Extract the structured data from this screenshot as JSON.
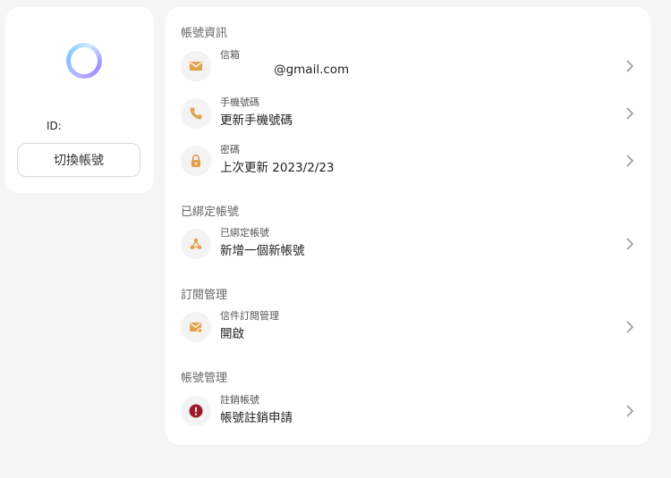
{
  "profile": {
    "id_label": "ID:",
    "switch_button": "切換帳號"
  },
  "sections": {
    "account_info": "帳號資訊",
    "bound_accounts": "已綁定帳號",
    "subscription": "訂閱管理",
    "account_management": "帳號管理"
  },
  "rows": {
    "email": {
      "label": "信箱",
      "value": "              @gmail.com",
      "icon": "mail-icon"
    },
    "phone": {
      "label": "手機號碼",
      "value": "更新手機號碼",
      "icon": "phone-icon"
    },
    "password": {
      "label": "密碼",
      "value": "上次更新 2023/2/23",
      "icon": "lock-icon"
    },
    "bound": {
      "label": "已綁定帳號",
      "value": "新增一個新帳號",
      "icon": "link-nodes-icon"
    },
    "mail_subscription": {
      "label": "信件訂閱管理",
      "value": "開啟",
      "icon": "mail-settings-icon"
    },
    "delete_account": {
      "label": "註銷帳號",
      "value": "帳號註銷申請",
      "icon": "alert-icon"
    }
  },
  "colors": {
    "accent": "#e0a24a",
    "danger": "#9b1c2a",
    "chevron": "#9a9a9a"
  }
}
